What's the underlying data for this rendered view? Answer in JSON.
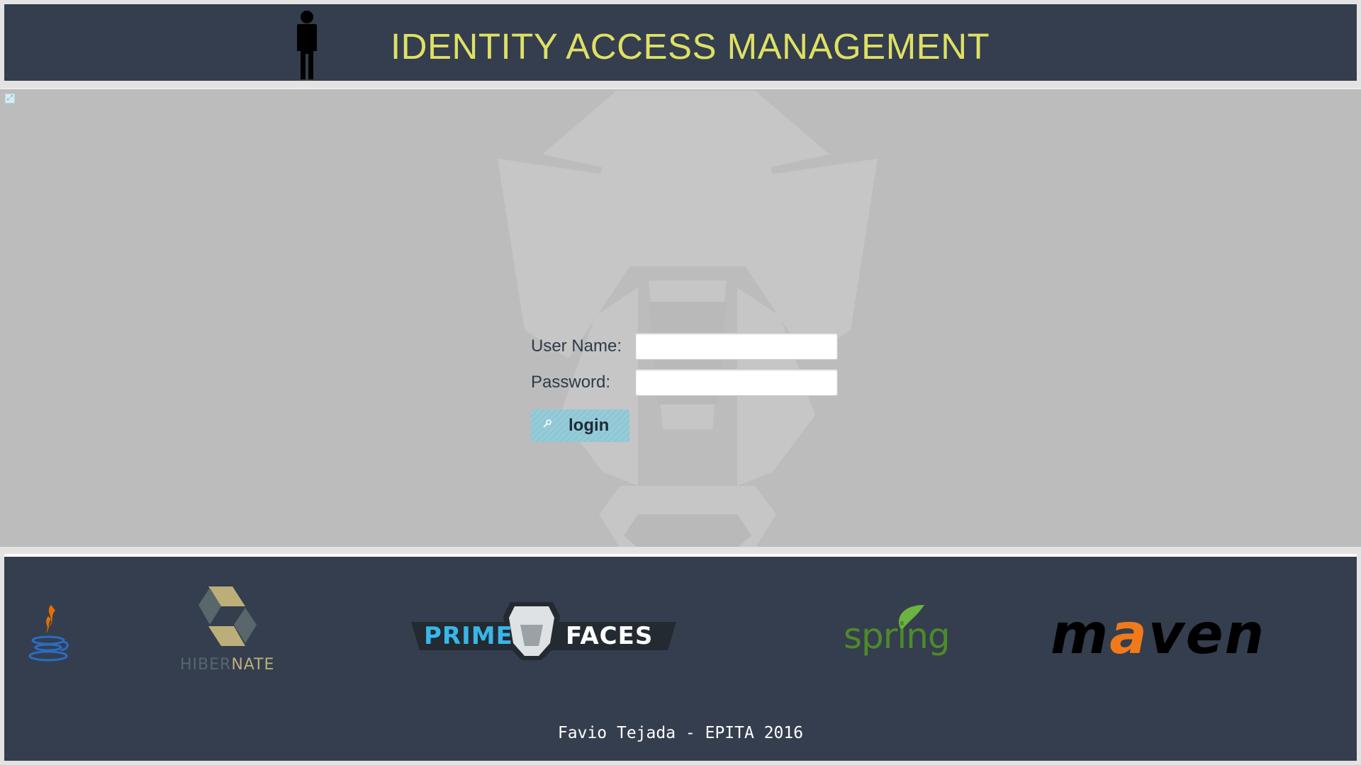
{
  "header": {
    "title": "IDENTITY ACCESS MANAGEMENT",
    "icon": "person-icon",
    "background": "#343e4e",
    "title_color": "#dfe064"
  },
  "login_form": {
    "username_label": "User Name:",
    "username_value": "",
    "password_label": "Password:",
    "password_value": "",
    "login_button_label": "login",
    "login_button_icon": "key-icon"
  },
  "footer": {
    "credit": "Favio Tejada - EPITA 2016",
    "logos": {
      "hibernate": {
        "part1": "HIBER",
        "part2": "NATE"
      },
      "primefaces": {
        "part1": "PRIME",
        "part2": "FACES"
      },
      "spring": "spring",
      "maven": {
        "part1": "m",
        "part2": "a",
        "part3": "ven"
      }
    }
  },
  "colors": {
    "panel_bg": "#bcbcbc",
    "button_bg": "#8ec7d4",
    "maven_accent": "#f07a1a",
    "spring_green": "#6db33f",
    "primefaces_blue": "#39b6e8"
  }
}
